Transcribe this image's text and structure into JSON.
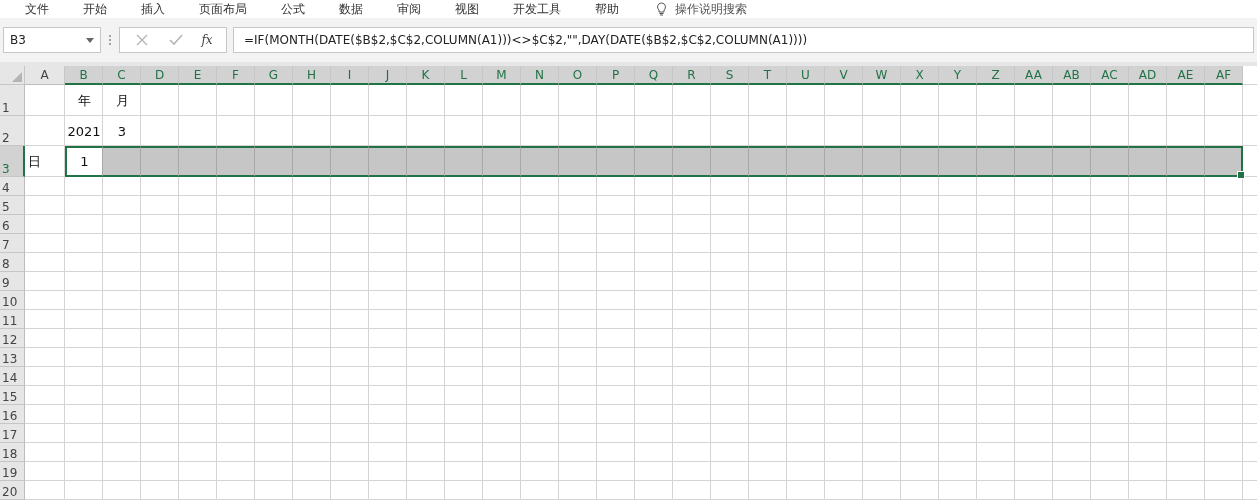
{
  "menu": [
    "文件",
    "开始",
    "插入",
    "页面布局",
    "公式",
    "数据",
    "审阅",
    "视图",
    "开发工具",
    "帮助"
  ],
  "tell_me": {
    "placeholder": "操作说明搜索"
  },
  "formula_bar": {
    "name_box": "B3",
    "fx": "fx",
    "formula": "=IF(MONTH(DATE($B$2,$C$2,COLUMN(A1)))<>$C$2,\"\",DAY(DATE($B$2,$C$2,COLUMN(A1))))",
    "cancel_disabled": true,
    "enter_disabled": true
  },
  "columns": [
    {
      "label": "A",
      "selected": false
    },
    {
      "label": "B",
      "selected": true
    },
    {
      "label": "C",
      "selected": true
    },
    {
      "label": "D",
      "selected": true
    },
    {
      "label": "E",
      "selected": true
    },
    {
      "label": "F",
      "selected": true
    },
    {
      "label": "G",
      "selected": true
    },
    {
      "label": "H",
      "selected": true
    },
    {
      "label": "I",
      "selected": true
    },
    {
      "label": "J",
      "selected": true
    },
    {
      "label": "K",
      "selected": true
    },
    {
      "label": "L",
      "selected": true
    },
    {
      "label": "M",
      "selected": true
    },
    {
      "label": "N",
      "selected": true
    },
    {
      "label": "O",
      "selected": true
    },
    {
      "label": "P",
      "selected": true
    },
    {
      "label": "Q",
      "selected": true
    },
    {
      "label": "R",
      "selected": true
    },
    {
      "label": "S",
      "selected": true
    },
    {
      "label": "T",
      "selected": true
    },
    {
      "label": "U",
      "selected": true
    },
    {
      "label": "V",
      "selected": true
    },
    {
      "label": "W",
      "selected": true
    },
    {
      "label": "X",
      "selected": true
    },
    {
      "label": "Y",
      "selected": true
    },
    {
      "label": "Z",
      "selected": true
    },
    {
      "label": "AA",
      "selected": true
    },
    {
      "label": "AB",
      "selected": true
    },
    {
      "label": "AC",
      "selected": true
    },
    {
      "label": "AD",
      "selected": true
    },
    {
      "label": "AE",
      "selected": true
    },
    {
      "label": "AF",
      "selected": true
    }
  ],
  "rows": [
    {
      "label": "1",
      "selected": false,
      "cells": [
        {
          "kind": "blank"
        },
        {
          "kind": "text",
          "text": "年"
        },
        {
          "kind": "text",
          "text": "月"
        }
      ]
    },
    {
      "label": "2",
      "selected": false,
      "cells": [
        {
          "kind": "blank"
        },
        {
          "kind": "text",
          "text": "2021"
        },
        {
          "kind": "text",
          "text": "3"
        }
      ]
    },
    {
      "label": "3",
      "selected": true,
      "cells": [
        {
          "kind": "text",
          "text": "日",
          "active": false
        },
        {
          "kind": "text",
          "text": "1",
          "active": true
        }
      ]
    },
    {
      "label": "4",
      "selected": false,
      "cells": []
    },
    {
      "label": "5",
      "selected": false,
      "cells": []
    },
    {
      "label": "6",
      "selected": false,
      "cells": []
    },
    {
      "label": "7",
      "selected": false,
      "cells": []
    },
    {
      "label": "8",
      "selected": false,
      "cells": []
    },
    {
      "label": "9",
      "selected": false,
      "cells": []
    },
    {
      "label": "10",
      "selected": false,
      "cells": []
    },
    {
      "label": "11",
      "selected": false,
      "cells": []
    },
    {
      "label": "12",
      "selected": false,
      "cells": []
    },
    {
      "label": "13",
      "selected": false,
      "cells": []
    },
    {
      "label": "14",
      "selected": false,
      "cells": []
    },
    {
      "label": "15",
      "selected": false,
      "cells": []
    },
    {
      "label": "16",
      "selected": false,
      "cells": []
    },
    {
      "label": "17",
      "selected": false,
      "cells": []
    },
    {
      "label": "18",
      "selected": false,
      "cells": []
    },
    {
      "label": "19",
      "selected": false,
      "cells": []
    },
    {
      "label": "20",
      "selected": false,
      "cells": []
    }
  ]
}
